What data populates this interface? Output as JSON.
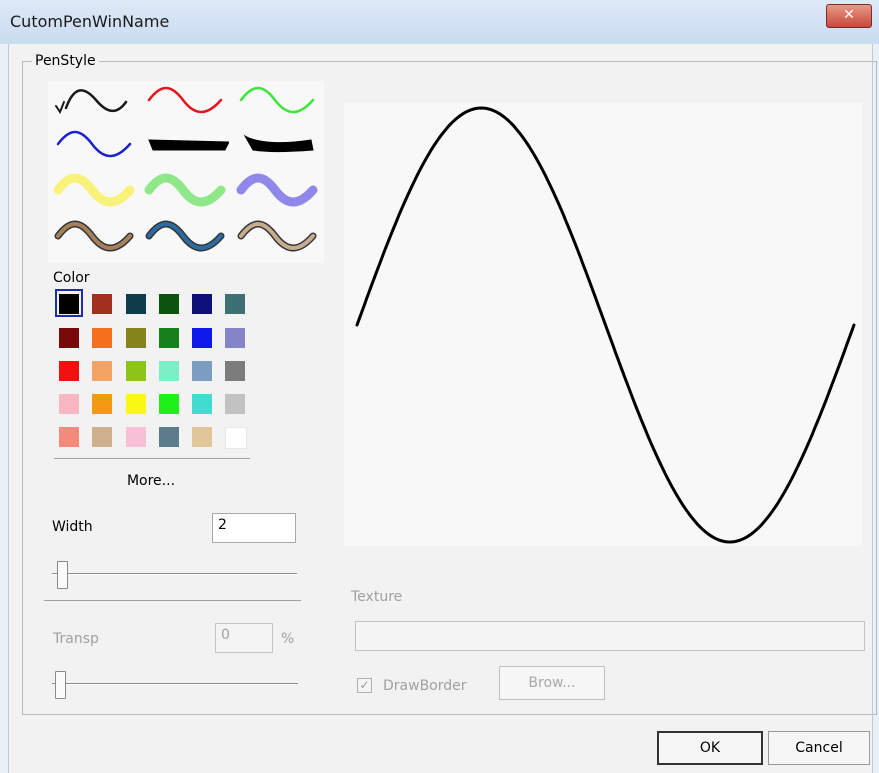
{
  "window": {
    "title": "CutomPenWinName",
    "close_icon": "close-icon ×"
  },
  "group": {
    "label": "PenStyle"
  },
  "pen_styles": [
    {
      "name": "pen-black-pencil",
      "color": "#1a1a1a"
    },
    {
      "name": "pen-red",
      "color": "#e8121c"
    },
    {
      "name": "pen-green",
      "color": "#3de63d"
    },
    {
      "name": "pen-blue",
      "color": "#1a20cc"
    },
    {
      "name": "pen-black-flat",
      "color": "#000000"
    },
    {
      "name": "pen-black-brush",
      "color": "#000000"
    },
    {
      "name": "pen-yellow-highlighter",
      "color": "#f8f27a"
    },
    {
      "name": "pen-green-highlighter",
      "color": "#8ee88a"
    },
    {
      "name": "pen-purple-highlighter",
      "color": "#8f88ea"
    },
    {
      "name": "pen-brown-bordered",
      "color": "#a4805c"
    },
    {
      "name": "pen-blue-textured",
      "color": "#2c6aa2"
    },
    {
      "name": "pen-bordered-light",
      "color": "#c7ad8f"
    }
  ],
  "color": {
    "label": "Color",
    "selected": "#000000",
    "swatches": [
      [
        "#000000",
        "#a1301d",
        "#0e3c4a",
        "#0c5310",
        "#0f0f7a",
        "#3e6f75"
      ],
      [
        "#7a0a0a",
        "#f5701e",
        "#85841a",
        "#16801a",
        "#0e18e8",
        "#8484c6"
      ],
      [
        "#f21010",
        "#f3a464",
        "#8ec41a",
        "#79f0c6",
        "#7b9dc2",
        "#7c7c7c"
      ],
      [
        "#f8b6c2",
        "#f39a14",
        "#f8f814",
        "#1ef01a",
        "#40dcd0",
        "#c2c2c2"
      ],
      [
        "#f38a7c",
        "#cfb08d",
        "#f8c0d6",
        "#5c7c8b",
        "#e1c69a",
        "#ffffff"
      ]
    ],
    "more_label": "More..."
  },
  "width": {
    "label": "Width",
    "value": "2",
    "slider_fraction": 0.06
  },
  "transp": {
    "label": "Transp",
    "value": "0",
    "unit": "%",
    "slider_fraction": 0.0
  },
  "texture": {
    "label": "Texture",
    "value": ""
  },
  "draw_border": {
    "label": "DrawBorder",
    "checked": true,
    "check_mark": "☑"
  },
  "browse": {
    "label": "Brow..."
  },
  "preview": {
    "stroke_color": "#000000"
  },
  "buttons": {
    "ok": "OK",
    "cancel": "Cancel"
  }
}
